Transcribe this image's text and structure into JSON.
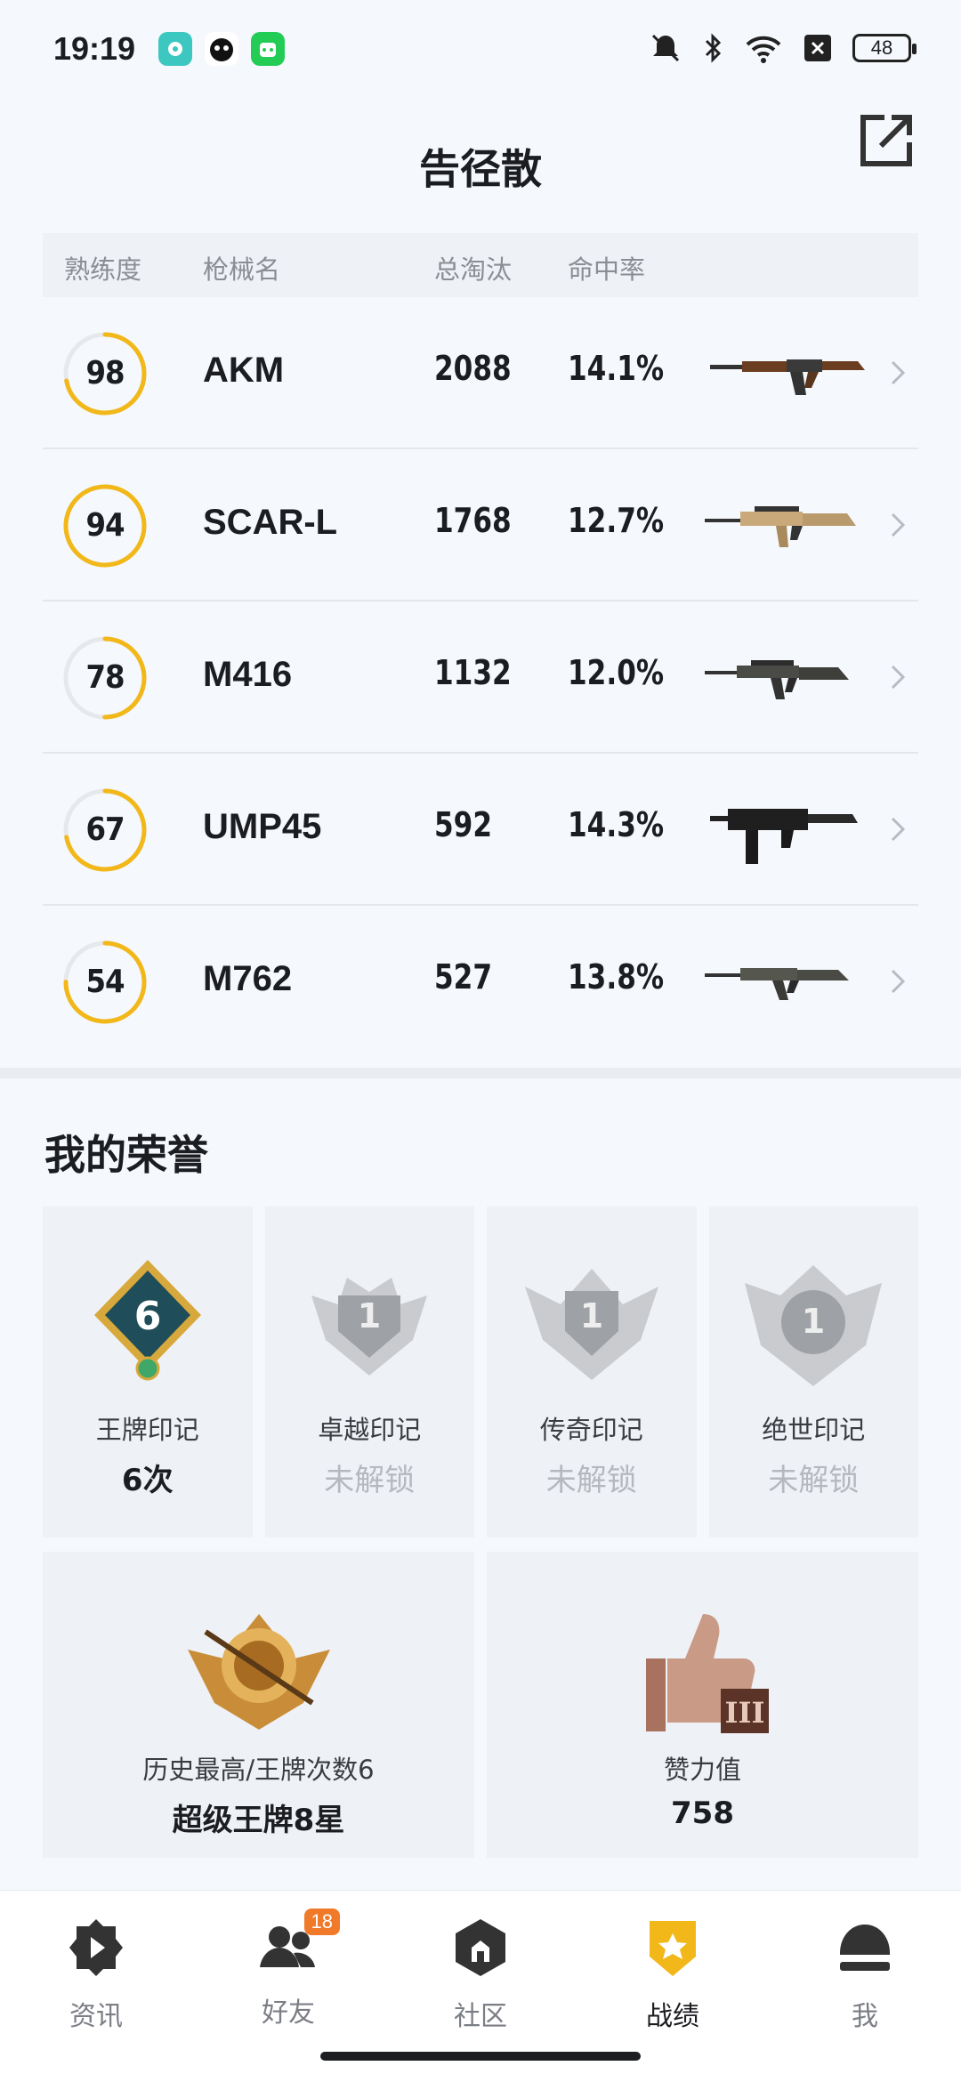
{
  "status_bar": {
    "time": "19:19",
    "battery": "48"
  },
  "header": {
    "title": "告径散"
  },
  "table": {
    "headers": {
      "proficiency": "熟练度",
      "gun": "枪械名",
      "kills": "总淘汰",
      "hit_rate": "命中率"
    },
    "rows": [
      {
        "proficiency": "98",
        "name": "AKM",
        "kills": "2088",
        "hit_rate": "14.1%",
        "progress": 0.72
      },
      {
        "proficiency": "94",
        "name": "SCAR-L",
        "kills": "1768",
        "hit_rate": "12.7%",
        "progress": 1.0
      },
      {
        "proficiency": "78",
        "name": "M416",
        "kills": "1132",
        "hit_rate": "12.0%",
        "progress": 0.5
      },
      {
        "proficiency": "67",
        "name": "UMP45",
        "kills": "592",
        "hit_rate": "14.3%",
        "progress": 0.72
      },
      {
        "proficiency": "54",
        "name": "M762",
        "kills": "527",
        "hit_rate": "13.8%",
        "progress": 0.75
      }
    ]
  },
  "honors": {
    "title": "我的荣誉",
    "badges": [
      {
        "label": "王牌印记",
        "value": "6次",
        "emblem_text": "6"
      },
      {
        "label": "卓越印记",
        "value": "未解锁",
        "emblem_text": "1"
      },
      {
        "label": "传奇印记",
        "value": "未解锁",
        "emblem_text": "1"
      },
      {
        "label": "绝世印记",
        "value": "未解锁",
        "emblem_text": "1"
      }
    ],
    "peak": {
      "label": "历史最高/王牌次数6",
      "value": "超级王牌8星"
    },
    "likes": {
      "label": "赞力值",
      "value": "758",
      "emblem_text": "III"
    }
  },
  "nav": {
    "items": [
      {
        "label": "资讯"
      },
      {
        "label": "好友",
        "badge": "18"
      },
      {
        "label": "社区"
      },
      {
        "label": "战绩"
      },
      {
        "label": "我"
      }
    ]
  },
  "colors": {
    "accent": "#f2b81a",
    "badge": "#f07a2a"
  }
}
